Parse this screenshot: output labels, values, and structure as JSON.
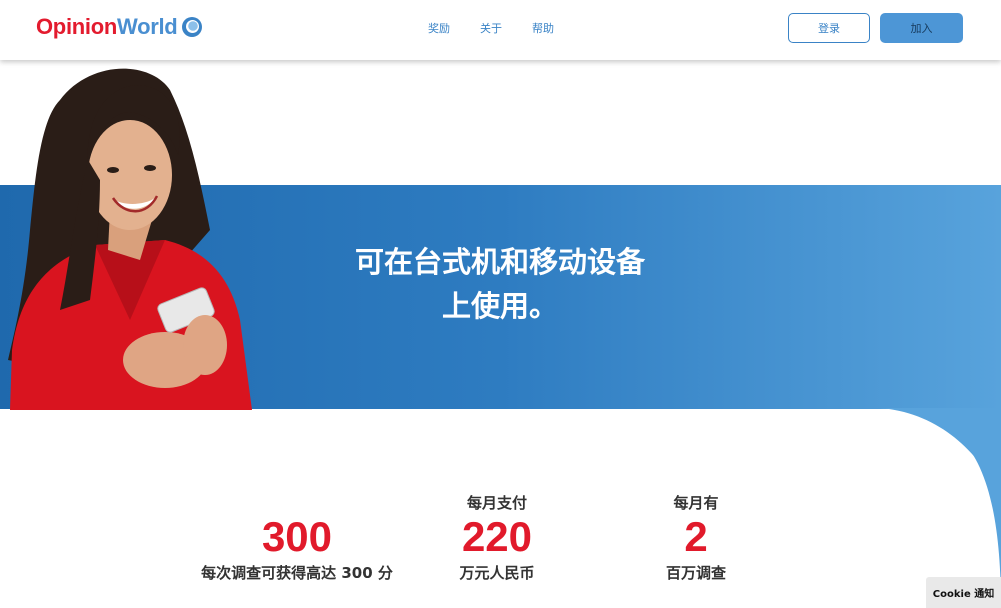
{
  "brand": {
    "name_part1": "Opinion",
    "name_part2": "World",
    "red": "#e31b2e",
    "blue": "#4a8fd1"
  },
  "nav": {
    "items": [
      {
        "label": "奖励"
      },
      {
        "label": "关于"
      },
      {
        "label": "帮助"
      }
    ]
  },
  "auth": {
    "login_label": "登录",
    "join_label": "加入"
  },
  "hero": {
    "heading_line1": "可在台式机和移动设备",
    "heading_line2": "上使用。",
    "image": "smiling-woman-holding-phone"
  },
  "stats": [
    {
      "prefix": "",
      "value": "300",
      "suffix": "每次调查可获得高达 300 分"
    },
    {
      "prefix": "每月支付",
      "value": "220",
      "suffix": "万元人民币"
    },
    {
      "prefix": "每月有",
      "value": "2",
      "suffix": "百万调查"
    }
  ],
  "cookie": {
    "label": "Cookie 通知"
  }
}
